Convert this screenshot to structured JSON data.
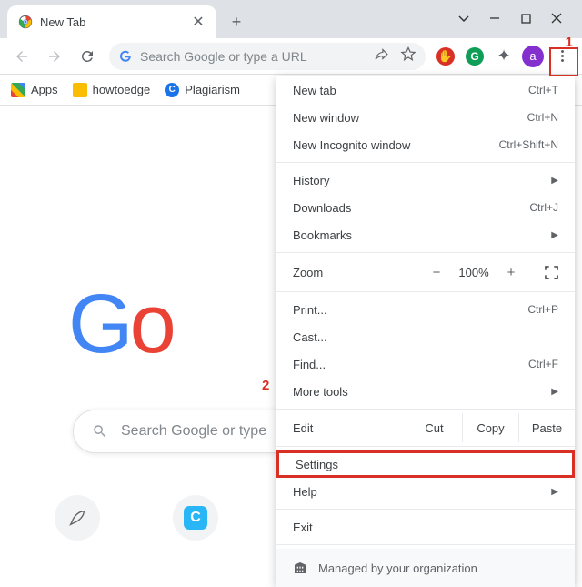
{
  "tab": {
    "title": "New Tab"
  },
  "omnibox": {
    "placeholder": "Search Google or type a URL"
  },
  "avatar": {
    "letter": "a"
  },
  "bookmarks": {
    "apps": "Apps",
    "howtoedge": "howtoedge",
    "plagiarism": "Plagiarism"
  },
  "search": {
    "placeholder": "Search Google or type"
  },
  "menu": {
    "newtab": {
      "label": "New tab",
      "shortcut": "Ctrl+T"
    },
    "newwin": {
      "label": "New window",
      "shortcut": "Ctrl+N"
    },
    "incognito": {
      "label": "New Incognito window",
      "shortcut": "Ctrl+Shift+N"
    },
    "history": {
      "label": "History"
    },
    "downloads": {
      "label": "Downloads",
      "shortcut": "Ctrl+J"
    },
    "bookmarks": {
      "label": "Bookmarks"
    },
    "zoom": {
      "label": "Zoom",
      "value": "100%"
    },
    "print": {
      "label": "Print...",
      "shortcut": "Ctrl+P"
    },
    "cast": {
      "label": "Cast..."
    },
    "find": {
      "label": "Find...",
      "shortcut": "Ctrl+F"
    },
    "moretools": {
      "label": "More tools"
    },
    "edit": {
      "label": "Edit",
      "cut": "Cut",
      "copy": "Copy",
      "paste": "Paste"
    },
    "settings": {
      "label": "Settings"
    },
    "help": {
      "label": "Help"
    },
    "exit": {
      "label": "Exit"
    },
    "managed": {
      "label": "Managed by your organization"
    }
  },
  "annotations": {
    "one": "1",
    "two": "2"
  }
}
